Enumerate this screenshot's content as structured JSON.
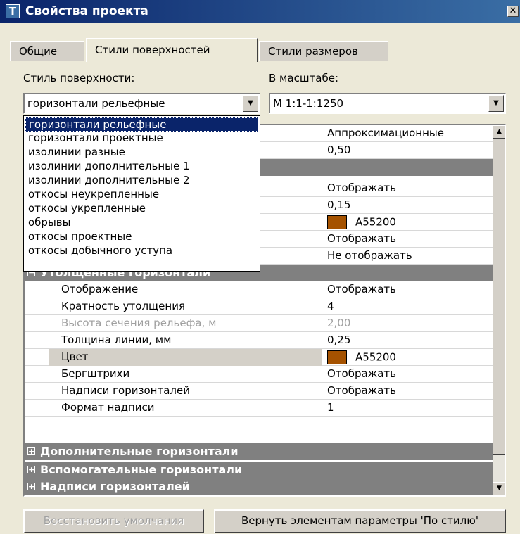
{
  "window": {
    "title": "Свойства проекта",
    "icon": "T",
    "close": "✕"
  },
  "tabs": [
    {
      "label": "Общие"
    },
    {
      "label": "Стили поверхностей"
    },
    {
      "label": "Стили размеров"
    }
  ],
  "surface_style": {
    "label": "Стиль поверхности:",
    "value": "горизонтали рельефные"
  },
  "scale": {
    "label": "В масштабе:",
    "value": "М 1:1-1:1250"
  },
  "dropdown": {
    "options": [
      "горизонтали рельефные",
      "горизонтали проектные",
      "изолинии разные",
      "изолинии дополнительные 1",
      "изолинии дополнительные 2",
      "откосы неукрепленные",
      "откосы укрепленные",
      "обрывы",
      "откосы проектные",
      "откосы добычного уступа"
    ],
    "selected": "горизонтали рельефные"
  },
  "grid": {
    "top_rows": [
      {
        "value": "Аппроксимационные"
      },
      {
        "value": "0,50"
      },
      {
        "value": ""
      },
      {
        "value": "Отображать"
      },
      {
        "value": "0,15"
      },
      {
        "value": "A55200"
      },
      {
        "value": "Отображать"
      },
      {
        "value": "Не отображать"
      }
    ],
    "category_thick": "Утолщенные горизонтали",
    "thick_rows": [
      {
        "name": "Отображение",
        "value": "Отображать"
      },
      {
        "name": "Кратность утолщения",
        "value": "4"
      },
      {
        "name": "Высота сечения рельефа, м",
        "value": "2,00"
      },
      {
        "name": "Толщина линии, мм",
        "value": "0,25"
      },
      {
        "name": "Цвет",
        "value": "A55200"
      },
      {
        "name": "Бергштрихи",
        "value": "Отображать"
      },
      {
        "name": "Надписи горизонталей",
        "value": "Отображать"
      },
      {
        "name": "Формат надписи",
        "value": "1"
      }
    ],
    "categories_bottom": [
      "Дополнительные горизонтали",
      "Вспомогательные горизонтали",
      "Надписи горизонталей"
    ],
    "color_hex": "#A55200"
  },
  "buttons": {
    "restore": "Восстановить умолчания",
    "apply_style": "Вернуть элементам параметры 'По стилю'"
  },
  "glyphs": {
    "minus": "−",
    "plus": "+",
    "down": "▼",
    "up": "▲"
  }
}
